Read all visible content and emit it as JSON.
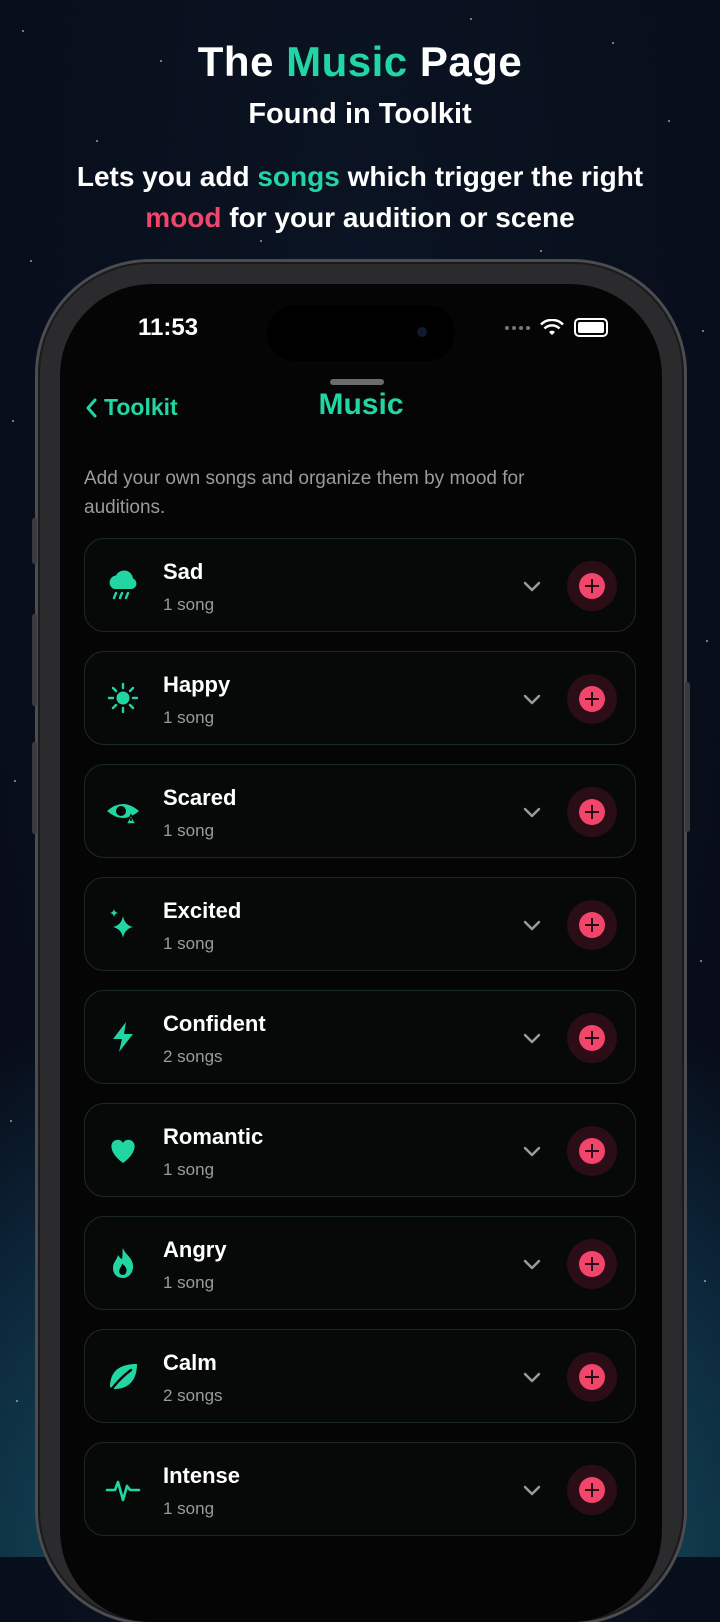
{
  "promo": {
    "title_pre": "The ",
    "title_accent": "Music",
    "title_post": " Page",
    "subtitle": "Found in Toolkit",
    "desc_1": "Lets you add ",
    "desc_accent_1": "songs",
    "desc_2": " which trigger the right",
    "desc_accent_2": "mood",
    "desc_3": " for your audition or scene"
  },
  "status_bar": {
    "time": "11:53"
  },
  "nav": {
    "back_label": "Toolkit",
    "title": "Music"
  },
  "intro": "Add your own songs and organize them by mood for auditions.",
  "moods": [
    {
      "name": "Sad",
      "count": "1 song",
      "icon": "rain-cloud-icon"
    },
    {
      "name": "Happy",
      "count": "1 song",
      "icon": "sun-icon"
    },
    {
      "name": "Scared",
      "count": "1 song",
      "icon": "eye-warning-icon"
    },
    {
      "name": "Excited",
      "count": "1 song",
      "icon": "sparkles-icon"
    },
    {
      "name": "Confident",
      "count": "2 songs",
      "icon": "lightning-icon"
    },
    {
      "name": "Romantic",
      "count": "1 song",
      "icon": "heart-icon"
    },
    {
      "name": "Angry",
      "count": "1 song",
      "icon": "flame-icon"
    },
    {
      "name": "Calm",
      "count": "2 songs",
      "icon": "leaf-icon"
    },
    {
      "name": "Intense",
      "count": "1 song",
      "icon": "pulse-icon"
    }
  ],
  "colors": {
    "accent": "#22d6a3",
    "add": "#f1456b",
    "background": "#050505"
  }
}
